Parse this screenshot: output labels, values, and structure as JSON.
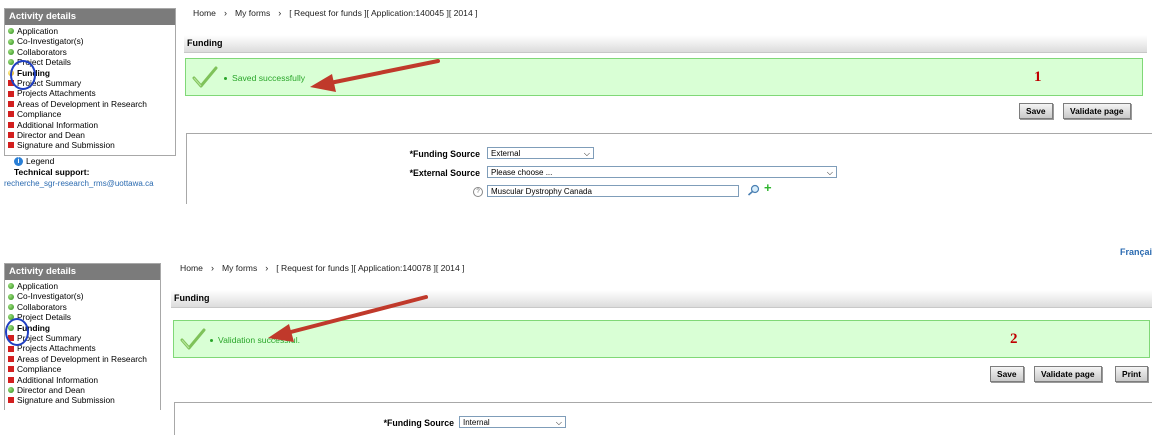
{
  "panel1": {
    "sidebar": {
      "header": "Activity details",
      "items": [
        {
          "label": "Application",
          "status": "green"
        },
        {
          "label": "Co-Investigator(s)",
          "status": "green"
        },
        {
          "label": "Collaborators",
          "status": "green"
        },
        {
          "label": "Project Details",
          "status": "green"
        },
        {
          "label": "Funding",
          "status": "yellow",
          "current": true
        },
        {
          "label": "Project Summary",
          "status": "red"
        },
        {
          "label": "Projects Attachments",
          "status": "red"
        },
        {
          "label": "Areas of Development in Research",
          "status": "red"
        },
        {
          "label": "Compliance",
          "status": "red"
        },
        {
          "label": "Additional Information",
          "status": "red"
        },
        {
          "label": "Director and Dean",
          "status": "red"
        },
        {
          "label": "Signature and Submission",
          "status": "red"
        }
      ],
      "legend_label": "Legend",
      "tech_support_label": "Technical support:",
      "support_email": "recherche_sgr-research_rms@uottawa.ca"
    },
    "breadcrumb": {
      "home": "Home",
      "sep": "›",
      "my_forms": "My forms",
      "current": "[ Request for funds ][ Application:140045 ][ 2014 ]"
    },
    "section_title": "Funding",
    "message": "Saved successfully",
    "marker": "1",
    "buttons": {
      "save": "Save",
      "validate": "Validate page"
    },
    "form": {
      "required_mark": "*",
      "funding_source_label": "Funding Source",
      "funding_source_value": "External",
      "external_source_label": "External Source",
      "external_source_value": "Please choose ...",
      "sponsor_value": "Muscular Dystrophy Canada"
    }
  },
  "panel2": {
    "language_link": "Françai",
    "sidebar": {
      "header": "Activity details",
      "items": [
        {
          "label": "Application",
          "status": "green"
        },
        {
          "label": "Co-Investigator(s)",
          "status": "green"
        },
        {
          "label": "Collaborators",
          "status": "green"
        },
        {
          "label": "Project Details",
          "status": "green"
        },
        {
          "label": "Funding",
          "status": "green",
          "current": true
        },
        {
          "label": "Project Summary",
          "status": "red"
        },
        {
          "label": "Projects Attachments",
          "status": "red"
        },
        {
          "label": "Areas of Development in Research",
          "status": "red"
        },
        {
          "label": "Compliance",
          "status": "red"
        },
        {
          "label": "Additional Information",
          "status": "red"
        },
        {
          "label": "Director and Dean",
          "status": "green"
        },
        {
          "label": "Signature and Submission",
          "status": "red"
        }
      ]
    },
    "breadcrumb": {
      "home": "Home",
      "sep": "›",
      "my_forms": "My forms",
      "current": "[ Request for funds ][ Application:140078 ][ 2014 ]"
    },
    "section_title": "Funding",
    "message": "Validation successful.",
    "marker": "2",
    "buttons": {
      "save": "Save",
      "validate": "Validate page",
      "print": "Print"
    },
    "form": {
      "required_mark": "*",
      "funding_source_label": "Funding Source",
      "funding_source_value": "Internal"
    }
  },
  "colors": {
    "accent_arrow": "#c0392b",
    "success_text": "#2aa62a",
    "success_bg": "#d9ffd5",
    "highlight_circle": "#1f3fc2",
    "marker": "#c00000"
  },
  "icons": {
    "status_complete": "green-dot-icon",
    "status_incomplete": "red-square-icon",
    "status_current": "yellow-dot-icon",
    "success": "checkmark-icon",
    "search": "magnifier-icon",
    "add": "plus-icon",
    "help": "help-icon"
  }
}
